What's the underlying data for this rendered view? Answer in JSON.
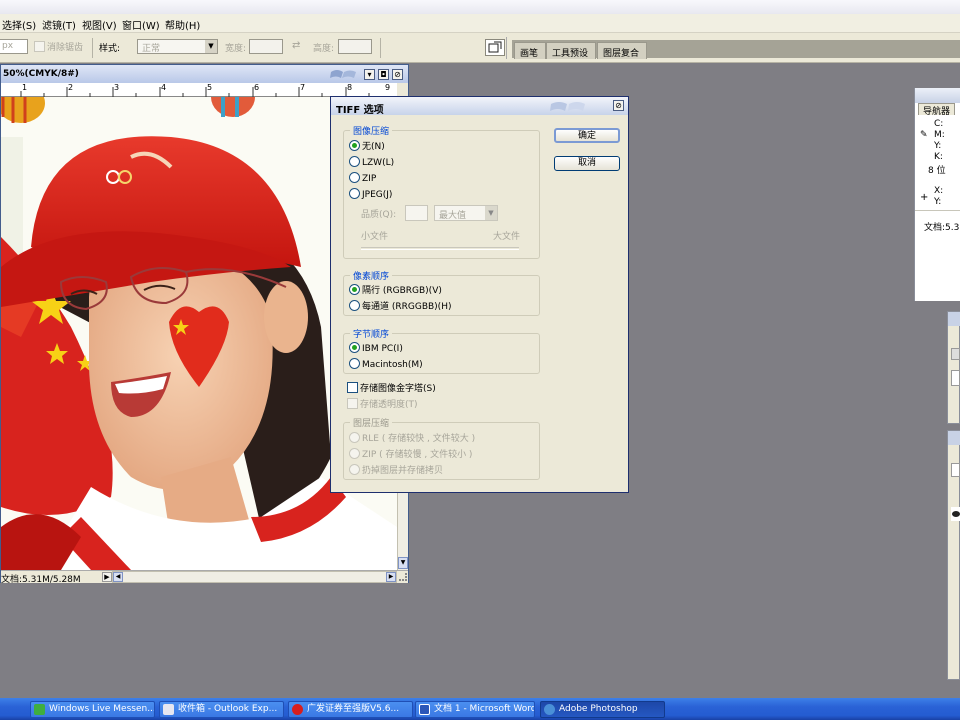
{
  "menubar": {
    "items": [
      "选择(S)",
      "滤镜(T)",
      "视图(V)",
      "窗口(W)",
      "帮助(H)"
    ]
  },
  "options": {
    "feather_unit": "px",
    "antialias_label": "消除锯齿",
    "style_label": "样式:",
    "style_value": "正常",
    "width_label": "宽度:",
    "height_label": "高度:",
    "swap_icon": "⇄"
  },
  "palette_tabs": [
    "画笔",
    "工具预设",
    "图层复合"
  ],
  "document": {
    "title": "50%(CMYK/8#)",
    "ruler_ticks": [
      "1",
      "2",
      "3",
      "4",
      "5",
      "6",
      "7",
      "8",
      "9"
    ],
    "status": "文档:5.31M/5.28M"
  },
  "tiff_dialog": {
    "title": "TIFF 选项",
    "ok_label": "确定",
    "cancel_label": "取消",
    "image_compression": {
      "title": "图像压缩",
      "options": [
        "无(N)",
        "LZW(L)",
        "ZIP",
        "JPEG(J)"
      ],
      "selected": "无(N)",
      "quality_label": "品质(Q):",
      "quality_value": "最大值",
      "small_file": "小文件",
      "large_file": "大文件"
    },
    "pixel_order": {
      "title": "像素顺序",
      "options": [
        "隔行 (RGBRGB)(V)",
        "每通道 (RRGGBB)(H)"
      ],
      "selected": "隔行 (RGBRGB)(V)"
    },
    "byte_order": {
      "title": "字节顺序",
      "options": [
        "IBM PC(I)",
        "Macintosh(M)"
      ],
      "selected": "IBM PC(I)"
    },
    "save_pyramid": "存储图像金字塔(S)",
    "save_transparency": "存储透明度(T)",
    "layer_compression": {
      "title": "图层压缩",
      "options": [
        "RLE ( 存储较快 , 文件较大 )",
        "ZIP ( 存储较慢 , 文件较小 )",
        "扔掉图层并存储拷贝"
      ]
    }
  },
  "navigator": {
    "tab": "导航器",
    "c": "C:",
    "m": "M:",
    "y": "Y:",
    "k": "K:",
    "bits": "8 位",
    "x": "X:",
    "yy": "Y:",
    "doc": "文档:5.3"
  },
  "taskbar": {
    "items": [
      {
        "label": "Windows Live Messen...",
        "color": "#3fae3f"
      },
      {
        "label": "收件箱 - Outlook Exp...",
        "color": "#e6e6f0"
      },
      {
        "label": "广发证券至强版V5.6...",
        "color": "#d81e1e"
      },
      {
        "label": "文档 1 - Microsoft Word",
        "color": "#2b56b8"
      },
      {
        "label": "Adobe Photoshop",
        "color": "#4a90d8"
      }
    ]
  },
  "colors": {
    "workspace": "#7f7e84",
    "dialog_bg": "#ece9d8",
    "accent_blue": "#0046d5",
    "cap_red": "#d8231e"
  }
}
